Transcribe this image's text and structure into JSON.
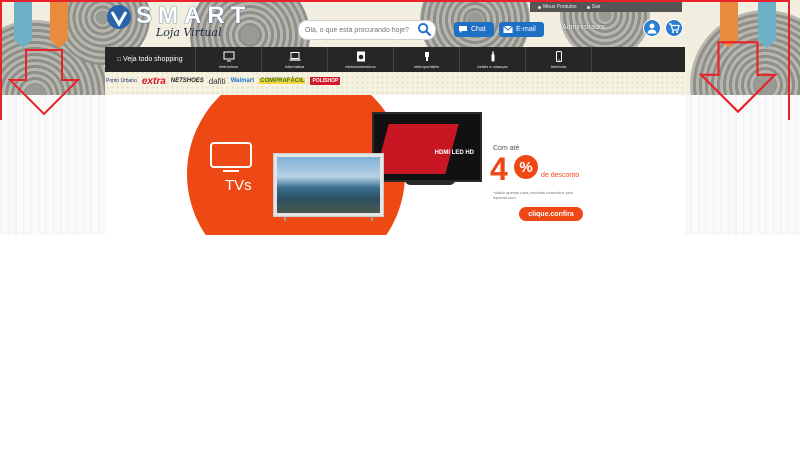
{
  "brand": {
    "name": "SMART",
    "tagline": "Loja Virtual"
  },
  "top_links": {
    "products": "Meus Produtos",
    "logout": "Sair"
  },
  "search": {
    "placeholder": "Olá, o que está procurando hoje?"
  },
  "contact": {
    "chat": "Chat",
    "email": "E-mail"
  },
  "admin": {
    "label": "Administrador"
  },
  "nav": {
    "main": "Veja todo shopping",
    "items": [
      {
        "label": "eletrônicos",
        "icon": "monitor-icon"
      },
      {
        "label": "informática",
        "icon": "laptop-icon"
      },
      {
        "label": "eletrodomésticos",
        "icon": "washing-machine-icon"
      },
      {
        "label": "eletroportáteis",
        "icon": "hair-dryer-icon"
      },
      {
        "label": "bebês e crianças",
        "icon": "baby-bottle-icon"
      },
      {
        "label": "telefonia",
        "icon": "smartphone-icon"
      }
    ]
  },
  "partners": [
    "Ponto Urbano",
    "extra",
    "NETSHOES",
    "dafiti",
    "Walmart",
    "COMPRAFÁCIL",
    "POLISHOP"
  ],
  "banner": {
    "category": "TVs",
    "tv_badge": "HDMI LED HD",
    "offer_prefix": "Com até",
    "offer_value": "4",
    "offer_percent": "%",
    "offer_suffix": "de desconto",
    "offer_note": "*valido apenas para produtos fornecidos pelo ikplmart.com",
    "cta": "clique.confira"
  },
  "colors": {
    "accent": "#ee4815",
    "nav_bg": "#262626",
    "button_blue": "#1f6fc5",
    "highlight_frame": "#e8222a"
  }
}
